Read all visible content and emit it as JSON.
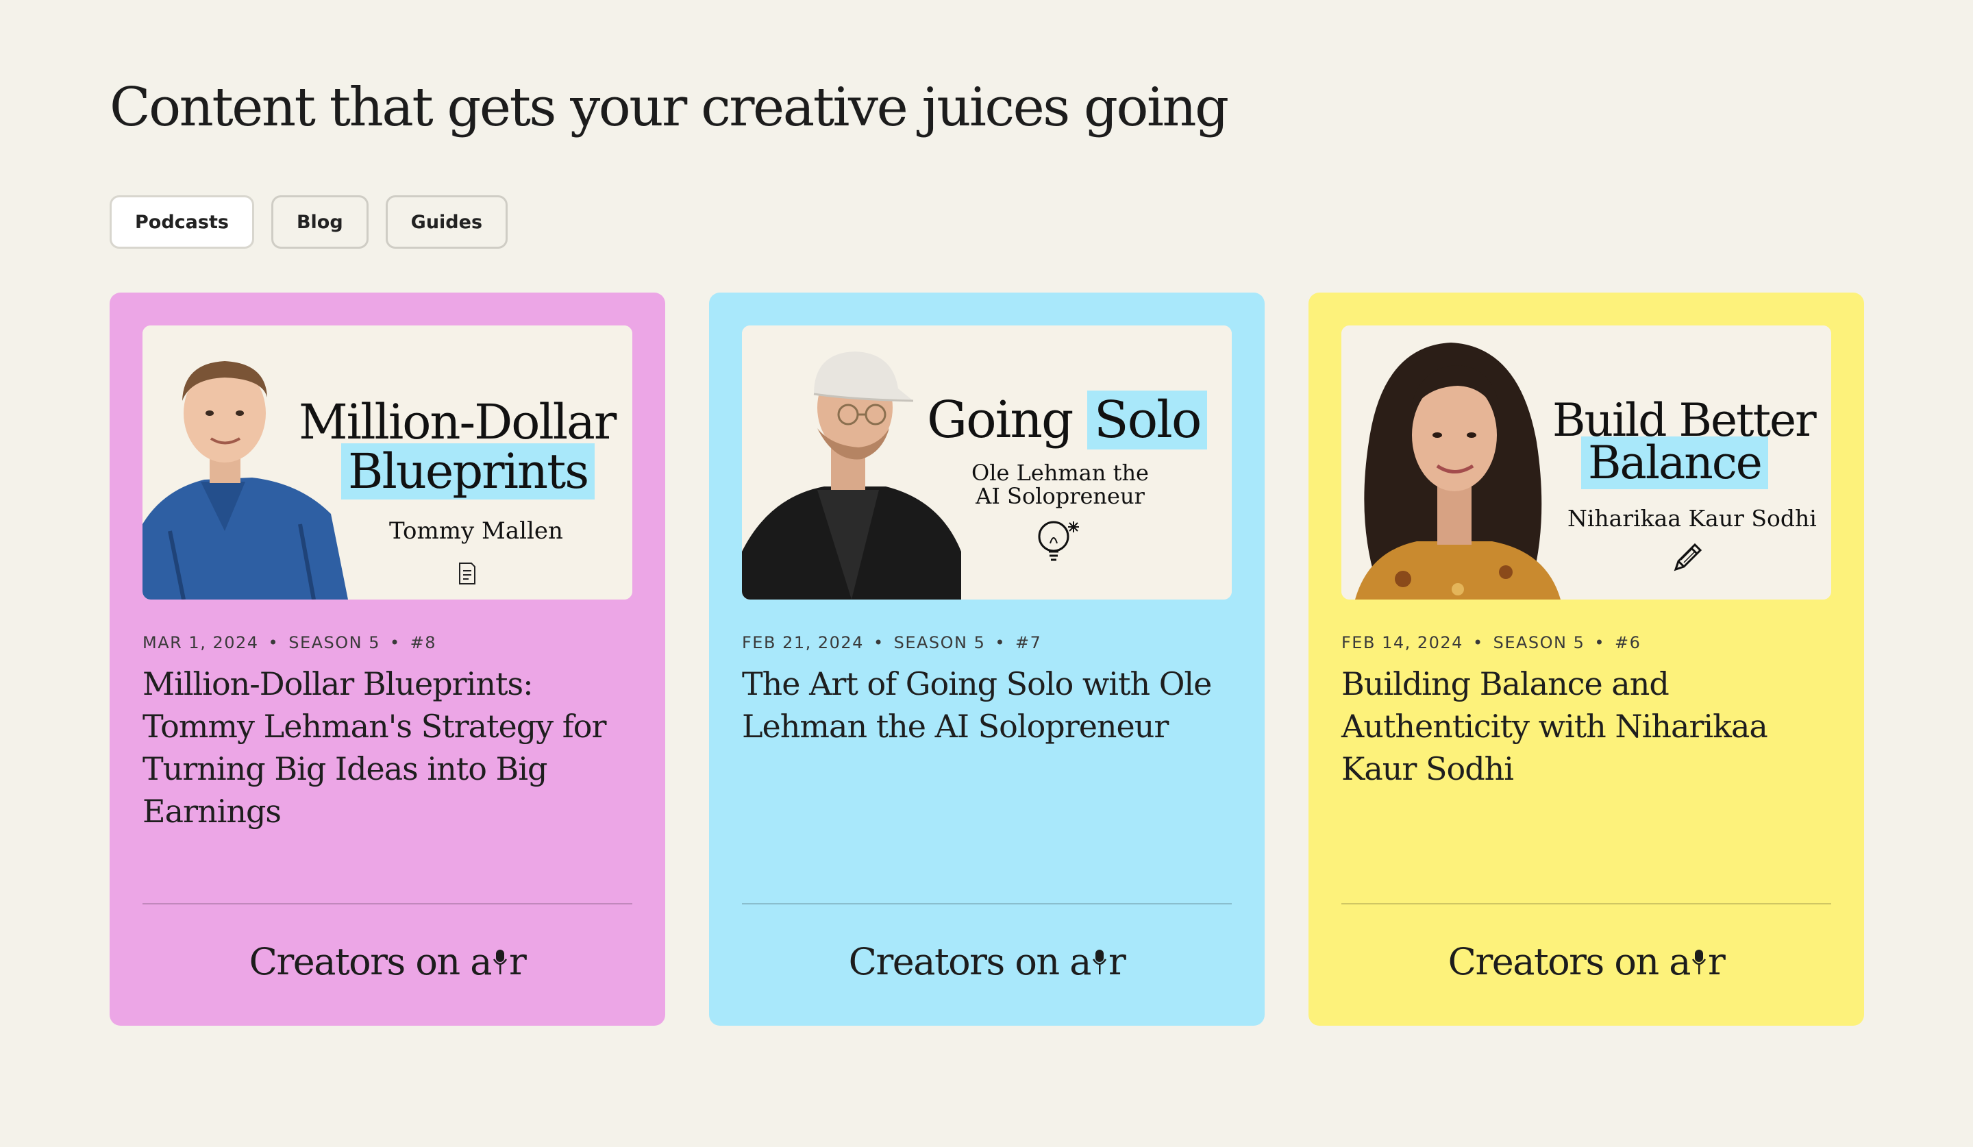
{
  "page": {
    "title": "Content that gets your creative juices going"
  },
  "filters": [
    {
      "label": "Podcasts",
      "active": true
    },
    {
      "label": "Blog",
      "active": false
    },
    {
      "label": "Guides",
      "active": false
    }
  ],
  "colors": {
    "background": "#f4f2ea",
    "pink": "#eca6e6",
    "blue": "#a9e8fb",
    "yellow": "#fdf27b",
    "highlight": "#a9e8fa"
  },
  "cards": [
    {
      "color": "#eca6e6",
      "thumb": {
        "line1": "Million-Dollar",
        "line2": "Blueprints",
        "guest": "Tommy Mallen",
        "icon": "document-icon"
      },
      "date": "MAR 1, 2024",
      "season": "SEASON 5",
      "episode": "#8",
      "title": "Million-Dollar Blueprints: Tommy Lehman's Strategy for Turning Big Ideas into Big Earnings",
      "brand": {
        "pre": "Creators on a",
        "post": "r"
      }
    },
    {
      "color": "#a9e8fb",
      "thumb": {
        "line1": "Going",
        "line2": "Solo",
        "guest_line1": "Ole Lehman the",
        "guest_line2": "AI  Solopreneur",
        "icon": "lightbulb-icon"
      },
      "date": "FEB 21, 2024",
      "season": "SEASON 5",
      "episode": "#7",
      "title": "The Art of Going Solo with Ole Lehman the AI Solopreneur",
      "brand": {
        "pre": "Creators on a",
        "post": "r"
      }
    },
    {
      "color": "#fdf27b",
      "thumb": {
        "line1": "Build Better",
        "line2": "Balance",
        "guest": "Niharikaa Kaur Sodhi",
        "icon": "pencil-icon"
      },
      "date": "FEB 14, 2024",
      "season": "SEASON 5",
      "episode": "#6",
      "title": "Building Balance and Authenticity with Niharikaa Kaur Sodhi",
      "brand": {
        "pre": "Creators on a",
        "post": "r"
      }
    }
  ]
}
